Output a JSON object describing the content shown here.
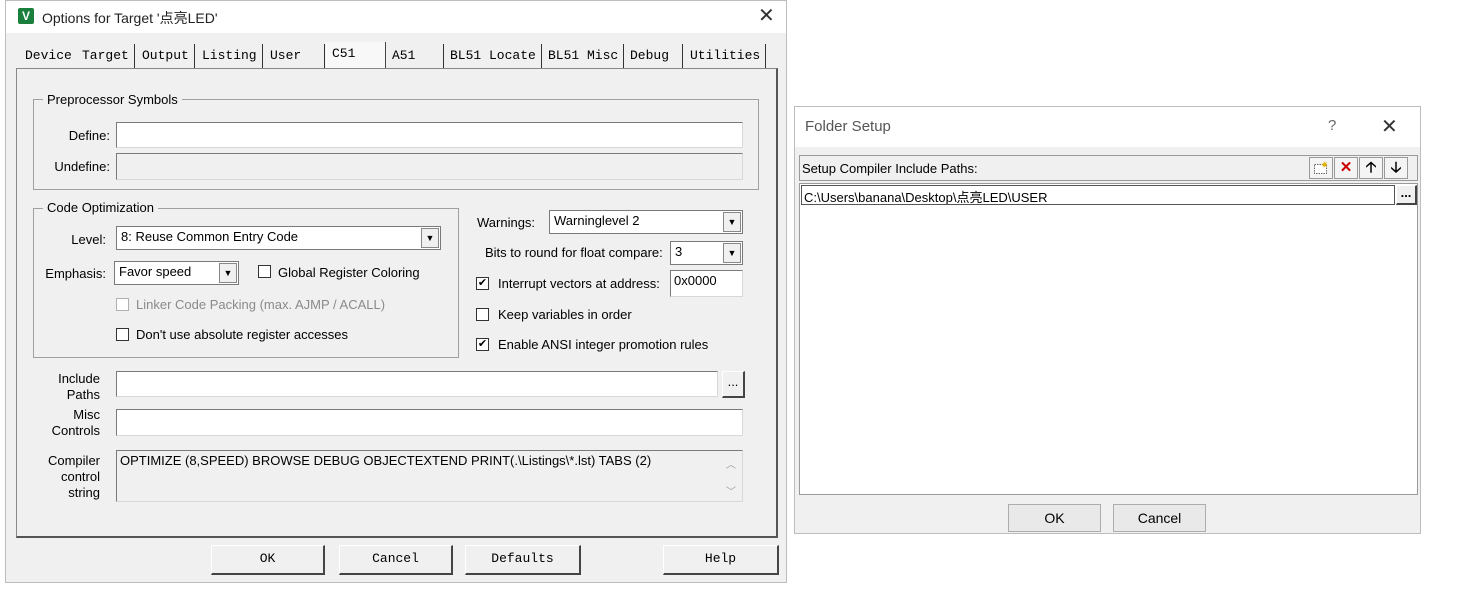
{
  "options_window": {
    "title": "Options for Target '点亮LED'",
    "tabs": [
      "Device",
      "Target",
      "Output",
      "Listing",
      "User",
      "C51",
      "A51",
      "BL51 Locate",
      "BL51 Misc",
      "Debug",
      "Utilities"
    ],
    "active_tab": "C51",
    "preprocessor": {
      "group_label": "Preprocessor Symbols",
      "define_label": "Define:",
      "define_value": "",
      "undefine_label": "Undefine:",
      "undefine_value": ""
    },
    "optimization": {
      "group_label": "Code Optimization",
      "level_label": "Level:",
      "level_value": "8: Reuse Common Entry Code",
      "emphasis_label": "Emphasis:",
      "emphasis_value": "Favor speed",
      "global_register_coloring": "Global Register Coloring",
      "global_register_coloring_checked": false,
      "linker_code_packing": "Linker Code Packing (max. AJMP / ACALL)",
      "linker_code_packing_checked": false,
      "no_absolute_register": "Don't use absolute register accesses",
      "no_absolute_register_checked": false
    },
    "right_options": {
      "warnings_label": "Warnings:",
      "warnings_value": "Warninglevel 2",
      "bits_label": "Bits to round for float compare:",
      "bits_value": "3",
      "interrupt_vectors_label": "Interrupt vectors at address:",
      "interrupt_vectors_checked": true,
      "interrupt_vectors_value": "0x0000",
      "keep_variables_label": "Keep variables in order",
      "keep_variables_checked": false,
      "ansi_promotion_label": "Enable ANSI integer promotion rules",
      "ansi_promotion_checked": true
    },
    "include_paths": {
      "label_line1": "Include",
      "label_line2": "Paths",
      "value": "",
      "browse": "..."
    },
    "misc_controls": {
      "label_line1": "Misc",
      "label_line2": "Controls",
      "value": ""
    },
    "compiler_string": {
      "label_line1": "Compiler",
      "label_line2": "control",
      "label_line3": "string",
      "value": "OPTIMIZE (8,SPEED) BROWSE DEBUG OBJECTEXTEND PRINT(.\\Listings\\*.lst) TABS (2)"
    },
    "buttons": {
      "ok": "OK",
      "cancel": "Cancel",
      "defaults": "Defaults",
      "help": "Help"
    }
  },
  "folder_setup": {
    "title": "Folder Setup",
    "help": "?",
    "header_label": "Setup Compiler Include Paths:",
    "toolbar_icons": [
      "new-folder-icon",
      "delete-icon",
      "move-up-icon",
      "move-down-icon"
    ],
    "paths": [
      "C:\\Users\\banana\\Desktop\\点亮LED\\USER"
    ],
    "browse": "...",
    "buttons": {
      "ok": "OK",
      "cancel": "Cancel"
    }
  },
  "colors": {
    "delete_icon": "#cc0000",
    "app_icon": "#1a7f3c"
  }
}
